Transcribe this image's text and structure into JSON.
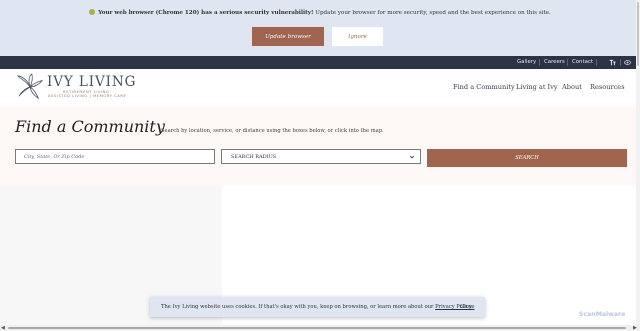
{
  "browser_notice": {
    "icon": "warning-icon",
    "message_bold": "Your web browser (Chrome 120) has a serious security vulnerability!",
    "message_rest": " Update your browser for more security, speed and the best experience on this site.",
    "update_label": "Update browser",
    "ignore_label": "Ignore"
  },
  "utility_nav": {
    "links": [
      "Gallery",
      "Careers",
      "Contact"
    ],
    "icons": [
      "text-size-icon",
      "eye-icon"
    ]
  },
  "logo": {
    "name": "IVY LIVING",
    "tagline1": "RETIREMENT LIVING",
    "tagline2": "ASSISTED LIVING | MEMORY CARE"
  },
  "main_nav": [
    "Find a Community",
    "Living at Ivy",
    "About",
    "Resources"
  ],
  "finder": {
    "title": "Find a Community",
    "hint": "Search by location, service, or distance using the boxes below, or click into the map.",
    "location_placeholder": "City, State, Or Zip Code",
    "radius_value": "SEARCH RADIUS",
    "search_label": "SEARCH"
  },
  "cookie": {
    "text_before": "The Ivy Living website uses cookies. If that's okay with you, keep on browsing, or learn more about our ",
    "policy_link": "Privacy Policy",
    "text_after": ".",
    "close_label": "Close"
  },
  "watermark": "ScanMalware",
  "colors": {
    "banner_bg": "#dfe6f1",
    "accent": "#a0644f",
    "utility_bar": "#2c3347",
    "finder_bg": "#fdf8f5"
  }
}
